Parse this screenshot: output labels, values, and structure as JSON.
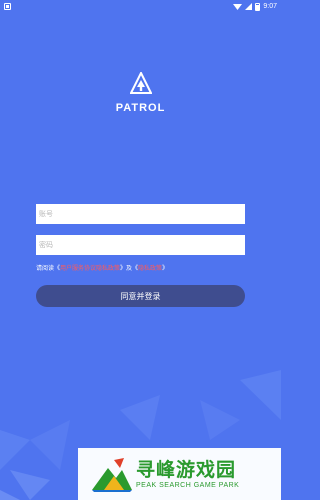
{
  "status_bar": {
    "time": "9:07"
  },
  "app": {
    "name": "PATROL"
  },
  "form": {
    "account_placeholder": "账号",
    "password_placeholder": "密码",
    "agreement_prefix": "请阅读《",
    "user_agreement": "用户服务协议隐私政策",
    "agreement_middle": "》及《",
    "privacy_policy": "隐私政策",
    "agreement_suffix": "》",
    "submit_label": "同意并登录"
  },
  "watermark": {
    "title": "寻峰游戏园",
    "subtitle": "PEAK SEARCH GAME PARK"
  },
  "colors": {
    "background": "#4f74ef",
    "button": "#3f4d8f",
    "link": "#ff5a5a",
    "watermark": "#2a9a2e"
  }
}
